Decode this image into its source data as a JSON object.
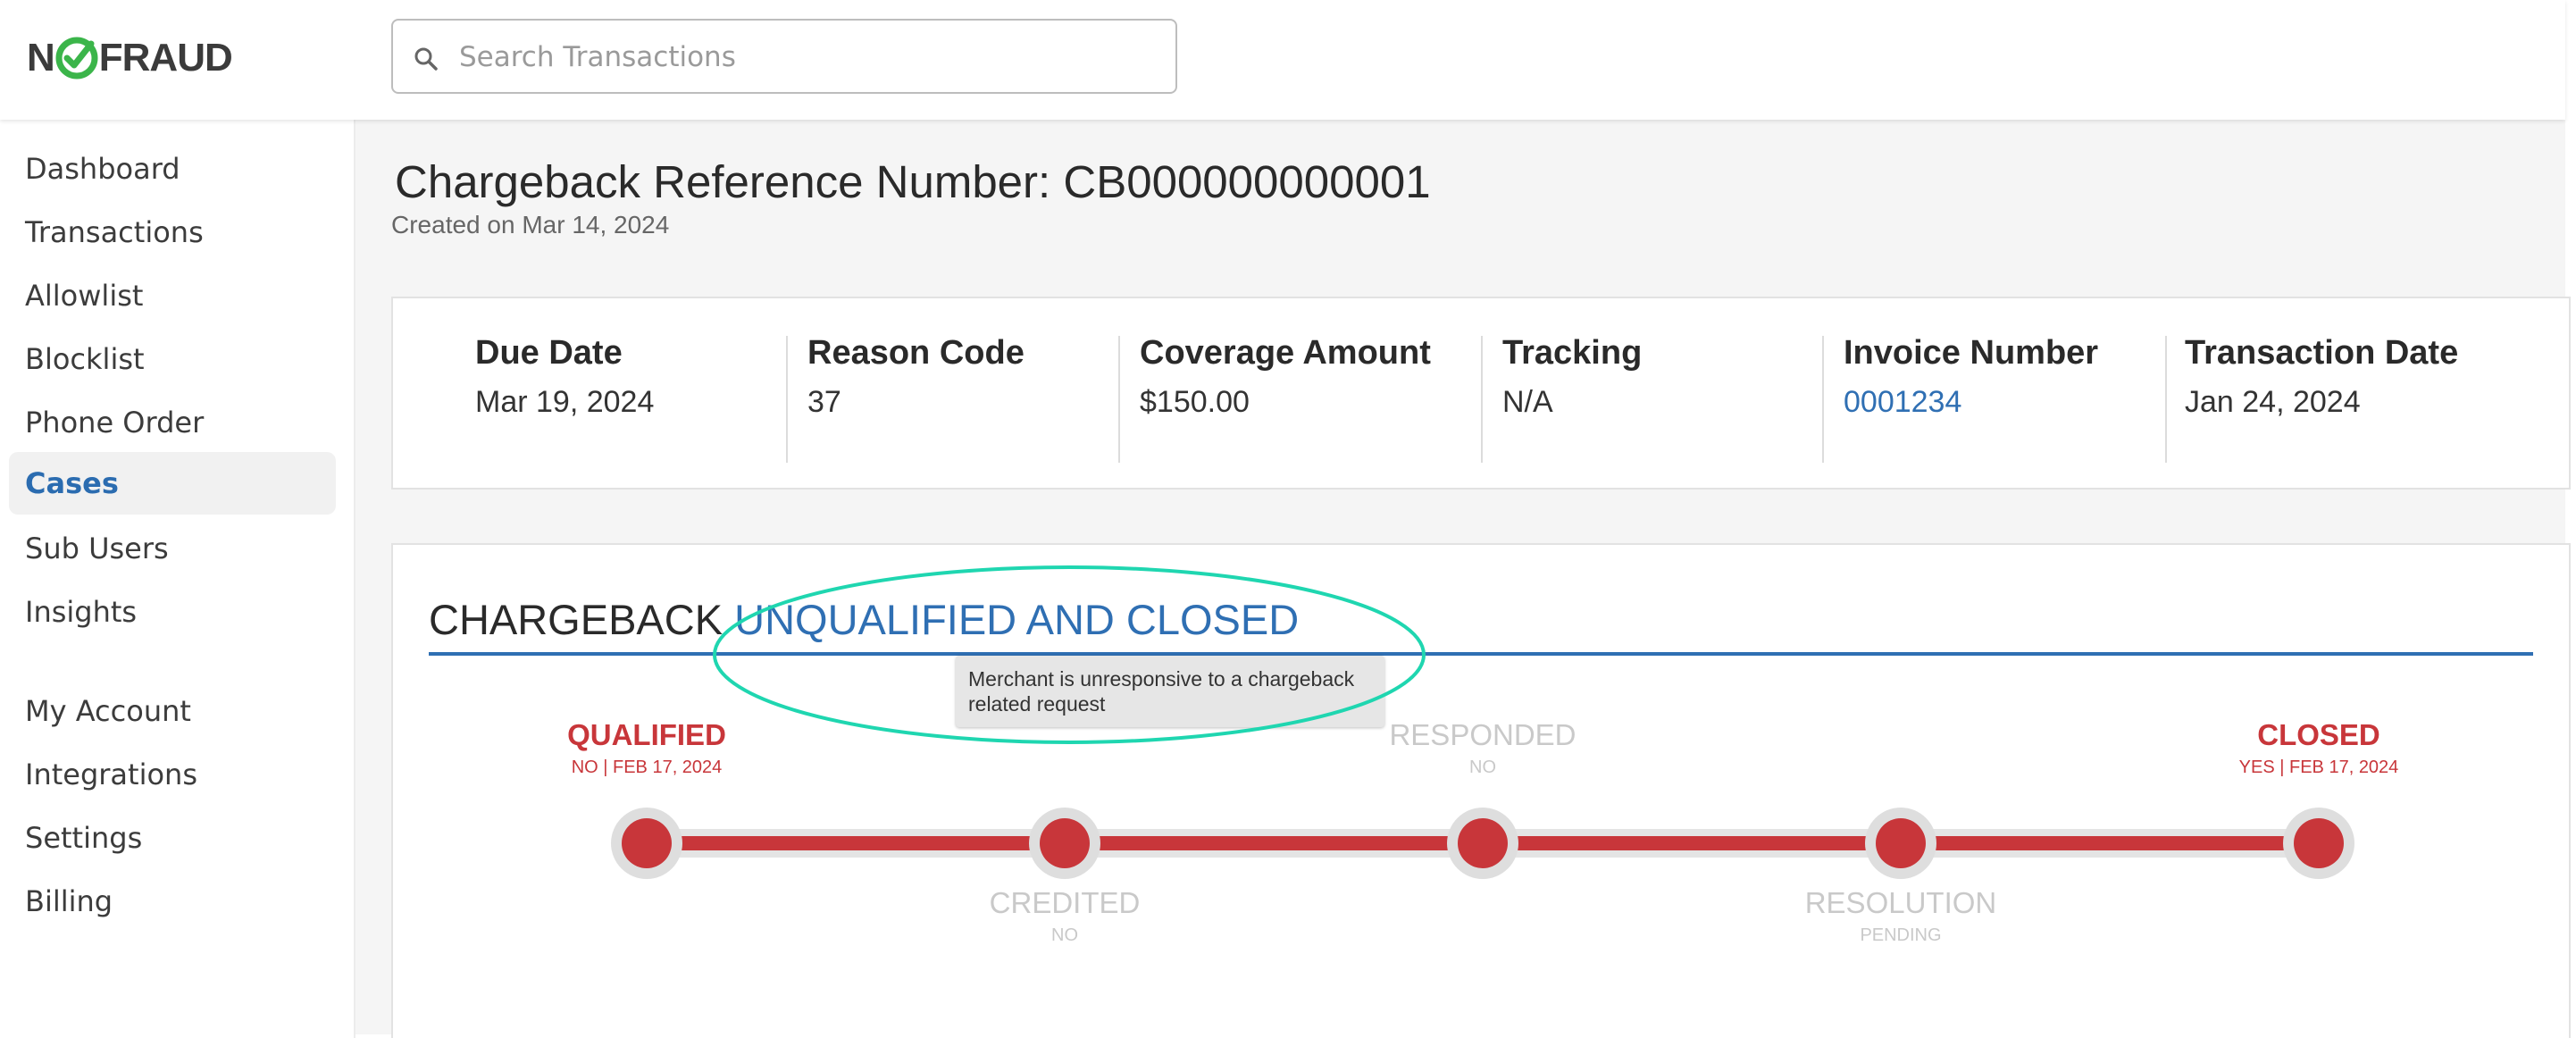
{
  "header": {
    "logo_text_left": "N",
    "logo_text_right": "FRAUD",
    "search_placeholder": "Search Transactions"
  },
  "sidebar": {
    "items": [
      {
        "label": "Dashboard"
      },
      {
        "label": "Transactions"
      },
      {
        "label": "Allowlist"
      },
      {
        "label": "Blocklist"
      },
      {
        "label": "Phone Order"
      },
      {
        "label": "Cases"
      },
      {
        "label": "Sub Users"
      },
      {
        "label": "Insights"
      },
      {
        "label": "My Account"
      },
      {
        "label": "Integrations"
      },
      {
        "label": "Settings"
      },
      {
        "label": "Billing"
      }
    ],
    "active": "Cases"
  },
  "page": {
    "title": "Chargeback Reference Number: CB000000000001",
    "created": "Created on Mar 14, 2024"
  },
  "summary": {
    "due_date": {
      "label": "Due Date",
      "value": "Mar 19, 2024"
    },
    "reason_code": {
      "label": "Reason Code",
      "value": "37"
    },
    "coverage_amount": {
      "label": "Coverage Amount",
      "value": "$150.00"
    },
    "tracking": {
      "label": "Tracking",
      "value": "N/A"
    },
    "invoice_number": {
      "label": "Invoice Number",
      "value": "0001234"
    },
    "transaction_date": {
      "label": "Transaction Date",
      "value": "Jan 24, 2024"
    }
  },
  "status": {
    "heading_prefix": "CHARGEBACK",
    "heading_status": "UNQUALIFIED AND CLOSED",
    "tooltip": "Merchant is unresponsive to a chargeback related request",
    "stages": [
      {
        "name": "QUALIFIED",
        "sub": "NO | FEB 17, 2024"
      },
      {
        "name": "CREDITED",
        "sub": "NO"
      },
      {
        "name": "RESPONDED",
        "sub": "NO"
      },
      {
        "name": "RESOLUTION",
        "sub": "PENDING"
      },
      {
        "name": "CLOSED",
        "sub": "YES | FEB 17, 2024"
      }
    ]
  },
  "colors": {
    "accent_blue": "#2f6fb3",
    "status_red": "#c8363a",
    "logo_green": "#3bb54a",
    "annotation_teal": "#1fd6b0"
  }
}
